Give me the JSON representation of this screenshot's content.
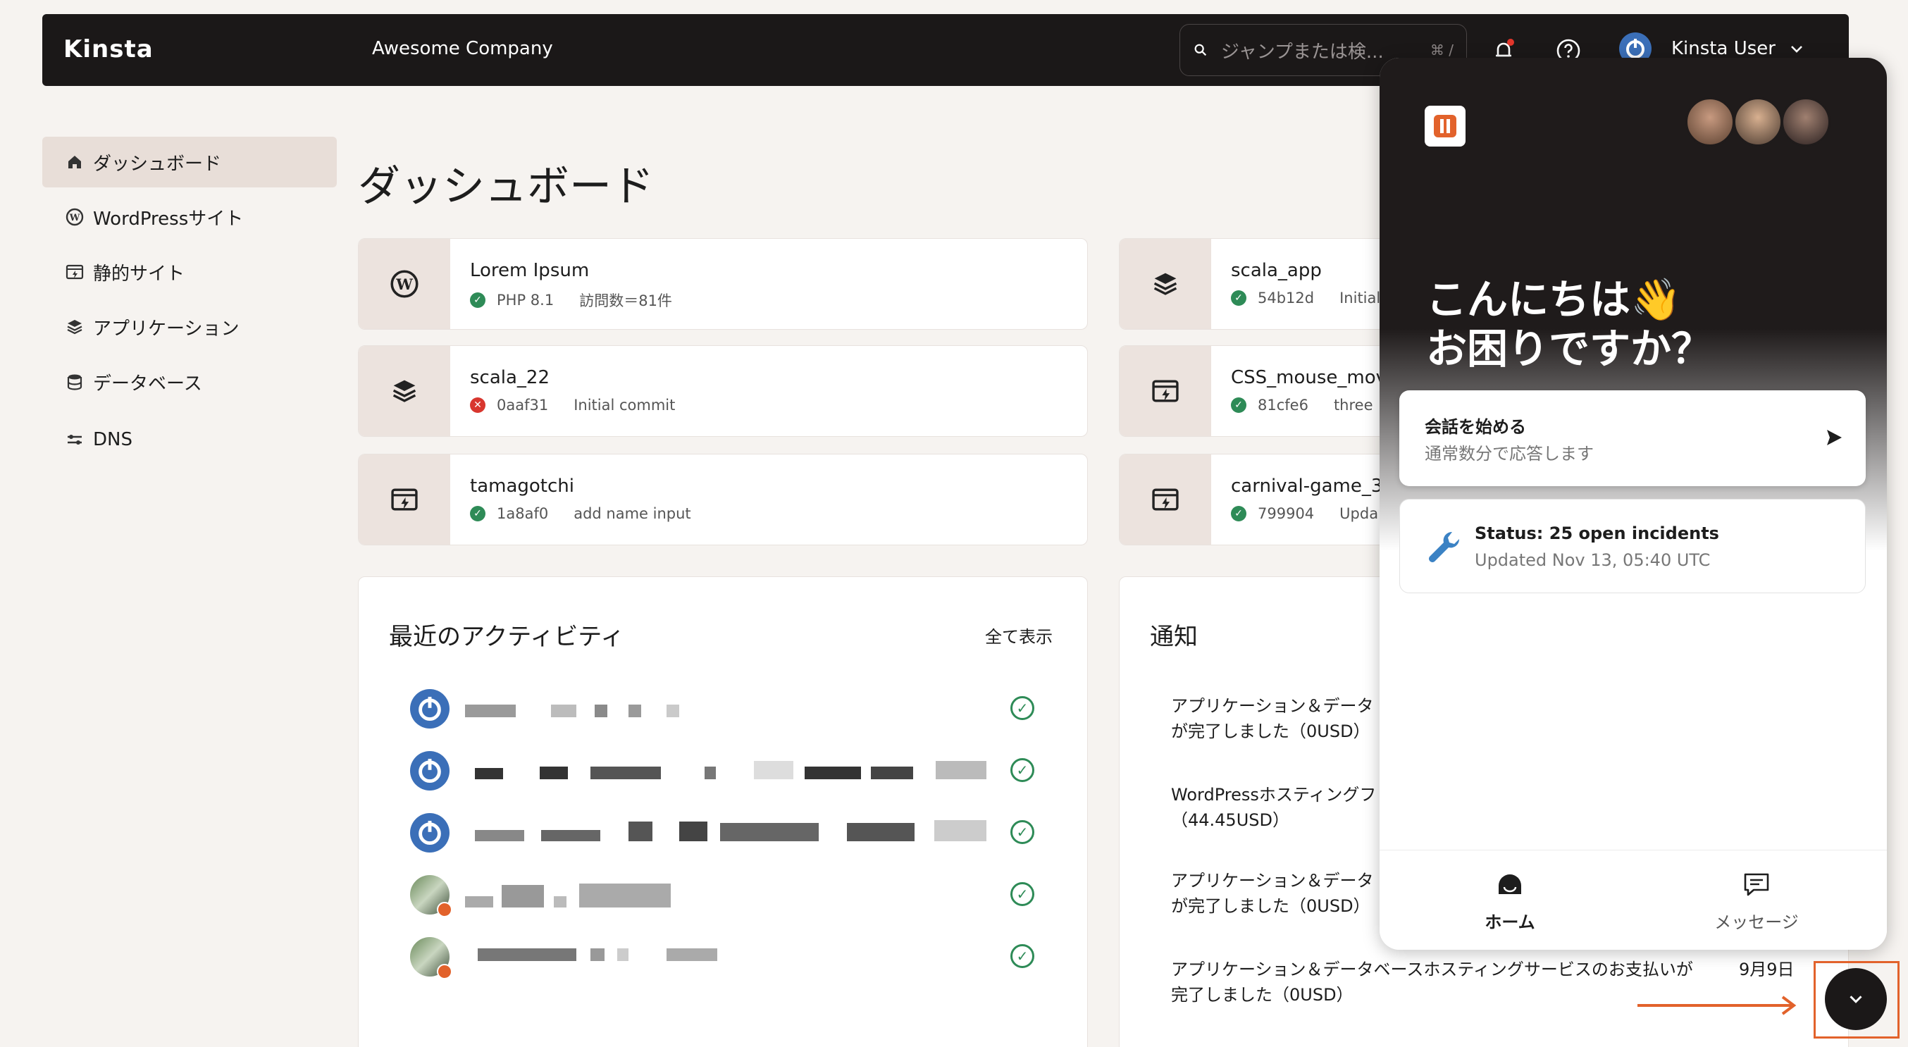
{
  "topbar": {
    "logo": "Kinsta",
    "company": "Awesome Company",
    "search_placeholder": "ジャンプまたは検...",
    "search_shortcut": "⌘ /",
    "username": "Kinsta User"
  },
  "sidebar": {
    "items": [
      {
        "label": "ダッシュボード",
        "icon": "home-icon",
        "active": true
      },
      {
        "label": "WordPressサイト",
        "icon": "wordpress-icon"
      },
      {
        "label": "静的サイト",
        "icon": "static-site-icon"
      },
      {
        "label": "アプリケーション",
        "icon": "layers-icon"
      },
      {
        "label": "データベース",
        "icon": "database-icon"
      },
      {
        "label": "DNS",
        "icon": "dns-icon"
      }
    ]
  },
  "main": {
    "title": "ダッシュボード",
    "cards": [
      {
        "name": "Lorem Ipsum",
        "hash": "PHP 8.1",
        "message": "訪問数＝81件",
        "status": "ok",
        "icon": "wordpress-icon"
      },
      {
        "name": "scala_app",
        "hash": "54b12d",
        "message": "Initial",
        "status": "ok",
        "icon": "layers-icon"
      },
      {
        "name": "scala_22",
        "hash": "0aaf31",
        "message": "Initial commit",
        "status": "error",
        "icon": "layers-icon"
      },
      {
        "name": "CSS_mouse_move",
        "hash": "81cfe6",
        "message": "three",
        "status": "ok",
        "icon": "static-site-icon"
      },
      {
        "name": "tamagotchi",
        "hash": "1a8af0",
        "message": "add name input",
        "status": "ok",
        "icon": "static-site-icon"
      },
      {
        "name": "carnival-game_3",
        "hash": "799904",
        "message": "Upda",
        "status": "ok",
        "icon": "static-site-icon"
      }
    ],
    "activity": {
      "title": "最近のアクティビティ",
      "view_all": "全て表示"
    },
    "notifications": {
      "title": "通知",
      "items": [
        {
          "text_1": "アプリケーション＆データ",
          "text_2": "が完了しました（0USD）"
        },
        {
          "text_1": "WordPressホスティングフ",
          "text_2": "（44.45USD）"
        },
        {
          "text_1": "アプリケーション＆データ",
          "text_2": "が完了しました（0USD）"
        },
        {
          "text_1": "アプリケーション＆データベースホスティングサービスのお支払いが",
          "text_2": "完了しました（0USD）",
          "date": "9月9日"
        }
      ]
    }
  },
  "chat": {
    "greeting_1": "こんにちは👋",
    "greeting_2": "お困りですか？",
    "start": {
      "title": "会話を始める",
      "subtitle": "通常数分で応答します"
    },
    "status": {
      "title": "Status: 25 open incidents",
      "subtitle": "Updated Nov 13, 05:40 UTC"
    },
    "nav": {
      "home": "ホーム",
      "messages": "メッセージ"
    }
  },
  "colors": {
    "topbar": "#1b1818",
    "accent_orange": "#e2622b",
    "status_ok": "#2e8b57",
    "status_error": "#d8362e"
  }
}
